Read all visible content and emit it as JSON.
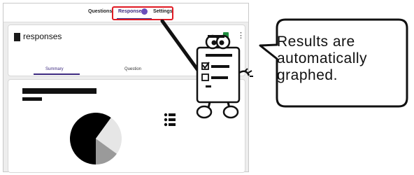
{
  "nav": {
    "tabs": [
      {
        "label": "Questions"
      },
      {
        "label": "Responses"
      },
      {
        "label": "Settings"
      }
    ]
  },
  "responses_card": {
    "title": "responses",
    "subtabs": [
      {
        "label": "Summary"
      },
      {
        "label": "Question"
      }
    ]
  },
  "chart_data": {
    "type": "pie",
    "values": [
      60,
      25,
      15
    ],
    "colors": [
      "#000000",
      "#e6e6e6",
      "#9a9a9a"
    ]
  },
  "callout": {
    "lines": [
      "Results are",
      "automatically",
      "graphed."
    ]
  }
}
